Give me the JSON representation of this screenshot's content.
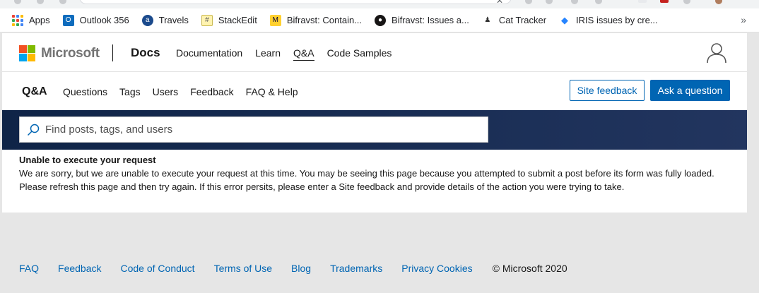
{
  "bookmarks": [
    {
      "label": "Apps",
      "icon": "apps-grid-icon"
    },
    {
      "label": "Outlook 356",
      "icon": "outlook-icon"
    },
    {
      "label": "Travels",
      "icon": "travels-icon"
    },
    {
      "label": "StackEdit",
      "icon": "stackedit-icon"
    },
    {
      "label": "Bifravst: Contain...",
      "icon": "miro-icon"
    },
    {
      "label": "Bifravst: Issues a...",
      "icon": "github-icon"
    },
    {
      "label": "Cat Tracker",
      "icon": "cat-tracker-icon"
    },
    {
      "label": "IRIS issues by cre...",
      "icon": "jira-icon"
    }
  ],
  "bookmarks_more": "»",
  "header": {
    "brand": "Microsoft",
    "product": "Docs",
    "nav": [
      "Documentation",
      "Learn",
      "Q&A",
      "Code Samples"
    ],
    "active_nav": "Q&A"
  },
  "subnav": {
    "title": "Q&A",
    "links": [
      "Questions",
      "Tags",
      "Users",
      "Feedback",
      "FAQ & Help"
    ],
    "feedback_button": "Site feedback",
    "ask_button": "Ask a question"
  },
  "search": {
    "placeholder": "Find posts, tags, and users",
    "value": ""
  },
  "error": {
    "title": "Unable to execute your request",
    "message": "We are sorry, but we are unable to execute your request at this time.  You may be seeing this page because you attempted to submit a post before its form was fully loaded. Please refresh this page and then try again. If this error persits, please enter a Site feedback and provide details of the action you were trying to take."
  },
  "footer": {
    "links": [
      "FAQ",
      "Feedback",
      "Code of Conduct",
      "Terms of Use",
      "Blog",
      "Trademarks",
      "Privacy Cookies"
    ],
    "copyright": "© Microsoft 2020"
  },
  "colors": {
    "accent": "#0065b3",
    "search_band": "#1a2e55",
    "footer_bg": "#e6e6e6"
  }
}
